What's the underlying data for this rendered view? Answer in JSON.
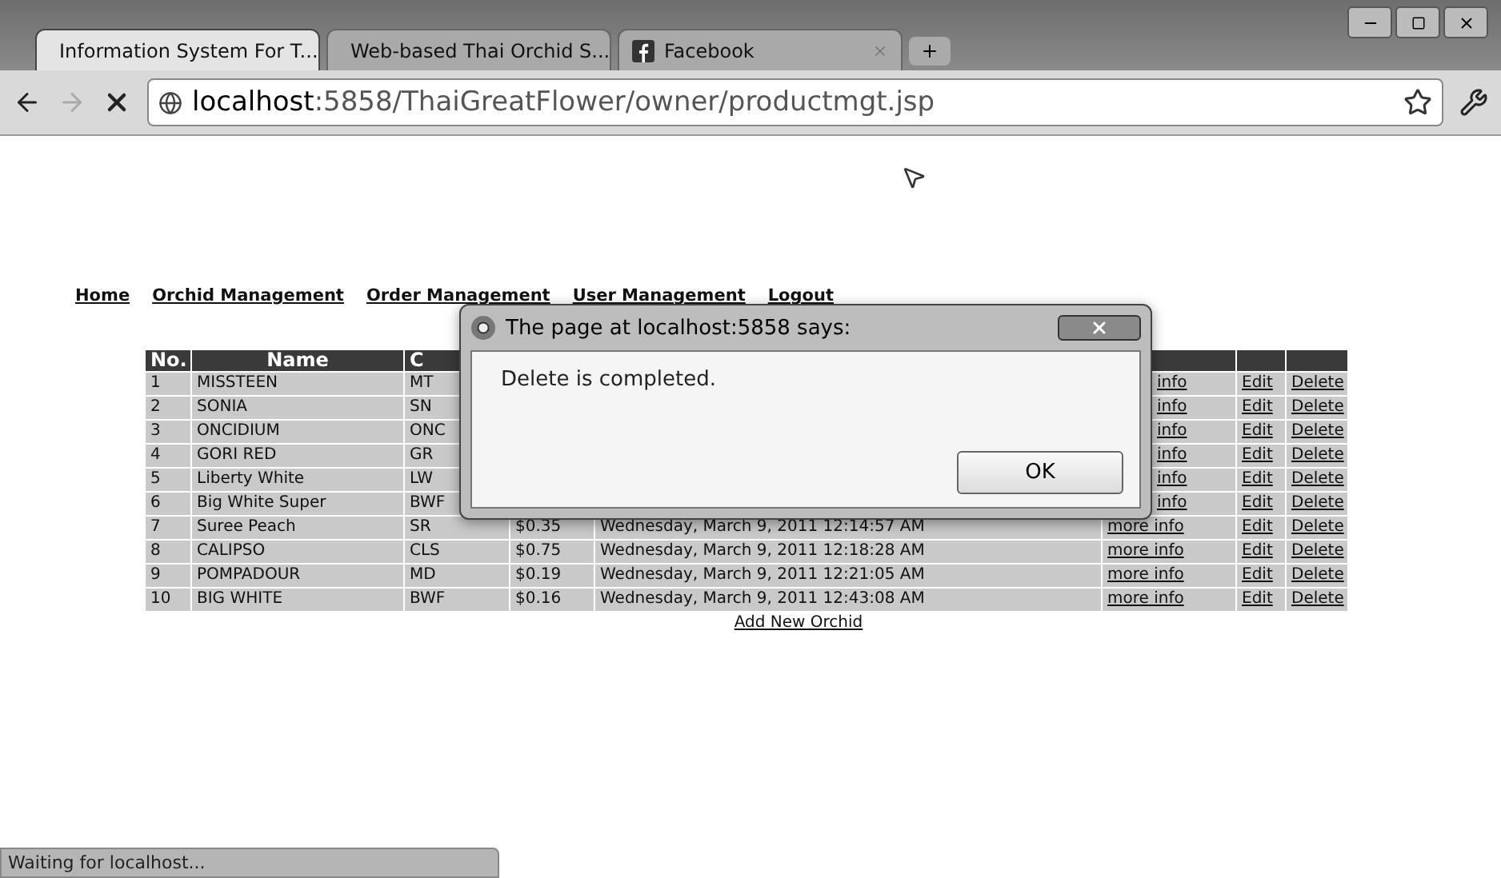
{
  "browser": {
    "tabs": [
      {
        "title": "Information System For T...",
        "selected": true,
        "kind": "page"
      },
      {
        "title": "Web-based Thai Orchid S...",
        "selected": false,
        "kind": "page"
      },
      {
        "title": "Facebook",
        "selected": false,
        "kind": "facebook"
      }
    ],
    "forward_disabled": true,
    "address": "**localhost**:5858/ThaiGreatFlower/owner/productmgt.jsp"
  },
  "nav": [
    "Home",
    "Orchid Management",
    "Order Management",
    "User Management",
    "Logout"
  ],
  "table": {
    "columns": [
      "No.",
      "Name",
      "C"
    ],
    "rows": [
      {
        "kind": "covered",
        "no": "1",
        "name": "MISSTEEN",
        "code": "MT",
        "info": "info",
        "edit": "Edit",
        "delete": "Delete"
      },
      {
        "kind": "covered",
        "no": "2",
        "name": "SONIA",
        "code": "SN",
        "info": "info",
        "edit": "Edit",
        "delete": "Delete"
      },
      {
        "kind": "covered",
        "no": "3",
        "name": "ONCIDIUM",
        "code": "ONC",
        "info": "info",
        "edit": "Edit",
        "delete": "Delete"
      },
      {
        "kind": "covered",
        "no": "4",
        "name": "GORI RED",
        "code": "GR",
        "info": "info",
        "edit": "Edit",
        "delete": "Delete"
      },
      {
        "kind": "covered",
        "no": "5",
        "name": "Liberty White",
        "code": "LW",
        "info": "info",
        "edit": "Edit",
        "delete": "Delete"
      },
      {
        "kind": "covered",
        "no": "6",
        "name": "Big White Super",
        "code": "BWF",
        "info": "info",
        "edit": "Edit",
        "delete": "Delete"
      },
      {
        "kind": "full",
        "no": "7",
        "name": "Suree Peach",
        "code": "SR",
        "price": "$0.35",
        "date": "Wednesday, March 9, 2011 12:14:57 AM",
        "info": "more info",
        "edit": "Edit",
        "delete": "Delete"
      },
      {
        "kind": "full",
        "no": "8",
        "name": "CALIPSO",
        "code": "CLS",
        "price": "$0.75",
        "date": "Wednesday, March 9, 2011 12:18:28 AM",
        "info": "more info",
        "edit": "Edit",
        "delete": "Delete"
      },
      {
        "kind": "full",
        "no": "9",
        "name": "POMPADOUR",
        "code": "MD",
        "price": "$0.19",
        "date": "Wednesday, March 9, 2011 12:21:05 AM",
        "info": "more info",
        "edit": "Edit",
        "delete": "Delete"
      },
      {
        "kind": "full",
        "no": "10",
        "name": "BIG WHITE",
        "code": "BWF",
        "price": "$0.16",
        "date": "Wednesday, March 9, 2011 12:43:08 AM",
        "info": "more info",
        "edit": "Edit",
        "delete": "Delete"
      }
    ],
    "add_link": "Add New Orchid"
  },
  "dialog": {
    "title": "The page at localhost:5858 says:",
    "message": "Delete is completed.",
    "button": "OK"
  },
  "status_bar": "Waiting for localhost..."
}
